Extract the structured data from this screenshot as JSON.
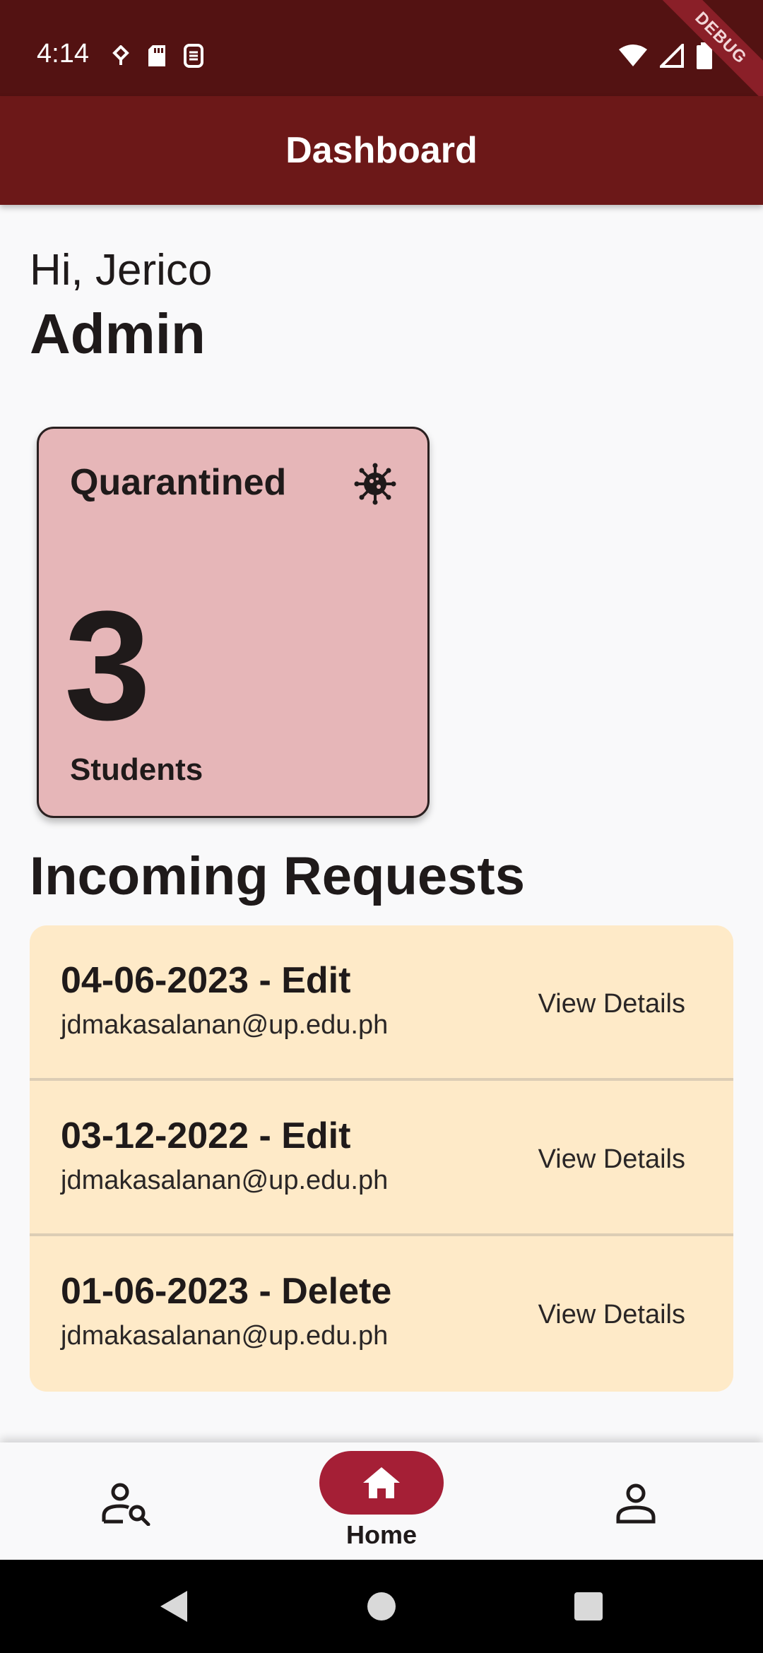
{
  "status_bar": {
    "time": "4:14",
    "left_icons": [
      "usb-debug-icon",
      "sd-card-icon",
      "sim-icon"
    ],
    "right_icons": [
      "wifi-icon",
      "signal-icon",
      "battery-icon"
    ],
    "debug_banner": "DEBUG"
  },
  "app_bar": {
    "title": "Dashboard"
  },
  "header": {
    "greeting": "Hi, Jerico",
    "role": "Admin"
  },
  "stat_card": {
    "title": "Quarantined",
    "icon": "virus-icon",
    "count": "3",
    "unit": "Students",
    "background": "#e6b6b8"
  },
  "requests": {
    "title": "Incoming Requests",
    "items": [
      {
        "title": "04-06-2023  - Edit",
        "email": "jdmakasalanan@up.edu.ph",
        "action": "View Details"
      },
      {
        "title": "03-12-2022  - Edit",
        "email": "jdmakasalanan@up.edu.ph",
        "action": "View Details"
      },
      {
        "title": "01-06-2023  - Delete",
        "email": "jdmakasalanan@up.edu.ph",
        "action": "View Details"
      }
    ],
    "background": "#feeac8"
  },
  "bottom_nav": {
    "items": [
      {
        "icon": "user-search-icon",
        "label": ""
      },
      {
        "icon": "home-icon",
        "label": "Home",
        "selected": true
      },
      {
        "icon": "person-icon",
        "label": ""
      }
    ],
    "accent": "#a51f36"
  },
  "system_nav": [
    "back-icon",
    "home-circle-icon",
    "recents-icon"
  ],
  "colors": {
    "status_bar": "#531212",
    "app_bar": "#6c1818",
    "background": "#f9f9fa"
  }
}
